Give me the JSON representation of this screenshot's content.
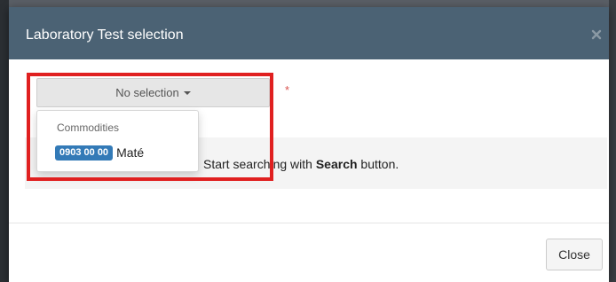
{
  "modal": {
    "title": "Laboratory Test selection",
    "close_icon": "close-x-icon"
  },
  "selector": {
    "label": "No selection",
    "caret_icon": "caret-down-icon",
    "required_marker": "*"
  },
  "dropdown_menu": {
    "header": "Commodities",
    "items": [
      {
        "code": "0903 00 00",
        "label": "Maté"
      }
    ]
  },
  "info_panel": {
    "text_before": "Start searching with ",
    "text_bold": "Search",
    "text_after": " button."
  },
  "footer": {
    "close_label": "Close"
  },
  "colors": {
    "header_bg": "#4b6274",
    "badge_bg": "#337ab7",
    "annotation": "#e02020",
    "required": "#d9534f"
  }
}
